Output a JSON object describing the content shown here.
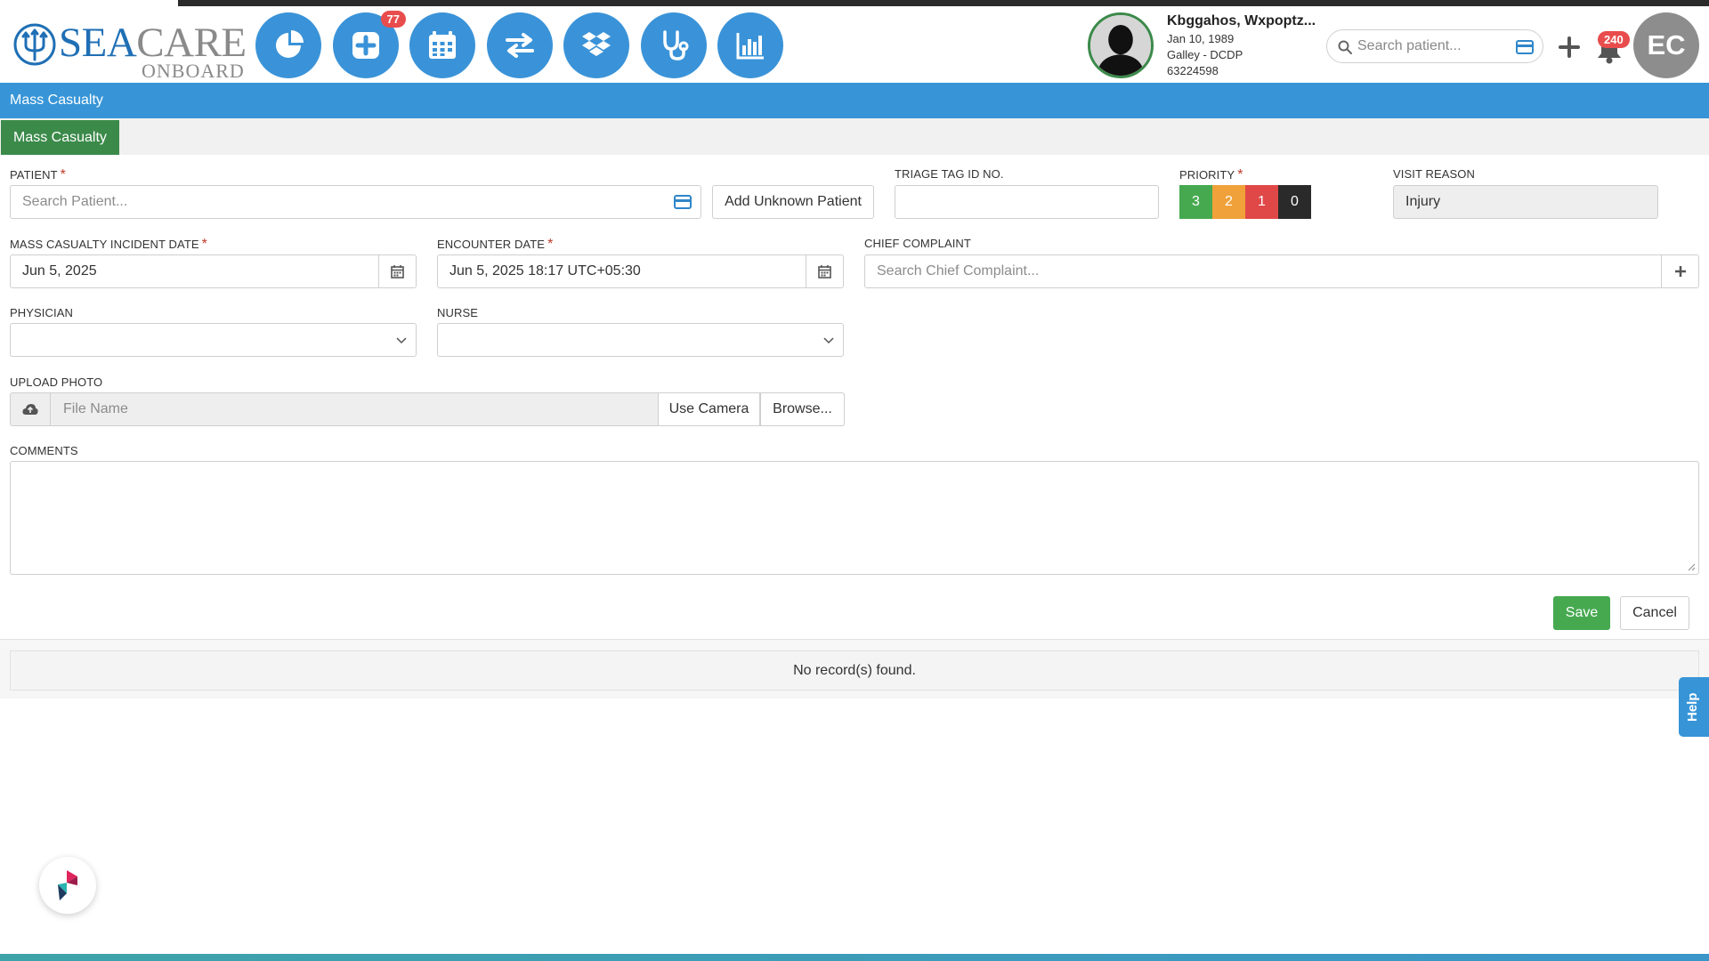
{
  "app": {
    "brand_sea": "SEA",
    "brand_care": "CARE",
    "brand_sub": "ONBOARD",
    "colors": {
      "primary": "#3795d7",
      "success": "#46a950",
      "tab_green": "#3b8a4a",
      "badge_red": "#e84c4c"
    }
  },
  "nav": {
    "icons": [
      {
        "name": "dashboard-pie-icon"
      },
      {
        "name": "add-encounter-icon",
        "badge": "77"
      },
      {
        "name": "calendar-icon"
      },
      {
        "name": "transfer-icon"
      },
      {
        "name": "dropbox-icon"
      },
      {
        "name": "stethoscope-icon"
      },
      {
        "name": "reports-chart-icon"
      }
    ]
  },
  "patient_card": {
    "name": "Kbggahos, Wxpoptz...",
    "dob": "Jan 10, 1989",
    "location": "Galley - DCDP",
    "id": "63224598"
  },
  "header_search": {
    "placeholder": "Search patient..."
  },
  "notifications": {
    "count": "240"
  },
  "user": {
    "initials": "EC"
  },
  "page": {
    "title": "Mass Casualty",
    "tab": "Mass Casualty"
  },
  "form": {
    "patient": {
      "label": "PATIENT",
      "placeholder": "Search Patient...",
      "value": ""
    },
    "add_unknown_label": "Add Unknown Patient",
    "triage_tag": {
      "label": "TRIAGE TAG ID NO.",
      "value": ""
    },
    "priority": {
      "label": "PRIORITY",
      "options": [
        {
          "label": "3",
          "color": "#46a950"
        },
        {
          "label": "2",
          "color": "#f0a13a"
        },
        {
          "label": "1",
          "color": "#e04848"
        },
        {
          "label": "0",
          "color": "#2a2a2a"
        }
      ]
    },
    "visit_reason": {
      "label": "VISIT REASON",
      "value": "Injury"
    },
    "incident_date": {
      "label": "MASS CASUALTY INCIDENT DATE",
      "value": "Jun 5, 2025"
    },
    "encounter_date": {
      "label": "ENCOUNTER DATE",
      "value": "Jun 5, 2025 18:17 UTC+05:30"
    },
    "chief_complaint": {
      "label": "CHIEF COMPLAINT",
      "placeholder": "Search Chief Complaint...",
      "value": ""
    },
    "physician": {
      "label": "PHYSICIAN",
      "value": ""
    },
    "nurse": {
      "label": "NURSE",
      "value": ""
    },
    "upload_photo": {
      "label": "UPLOAD PHOTO",
      "placeholder": "File Name",
      "camera_label": "Use Camera",
      "browse_label": "Browse..."
    },
    "comments": {
      "label": "COMMENTS",
      "value": ""
    },
    "save_label": "Save",
    "cancel_label": "Cancel"
  },
  "records": {
    "empty_text": "No record(s) found."
  },
  "help": {
    "label": "Help"
  }
}
